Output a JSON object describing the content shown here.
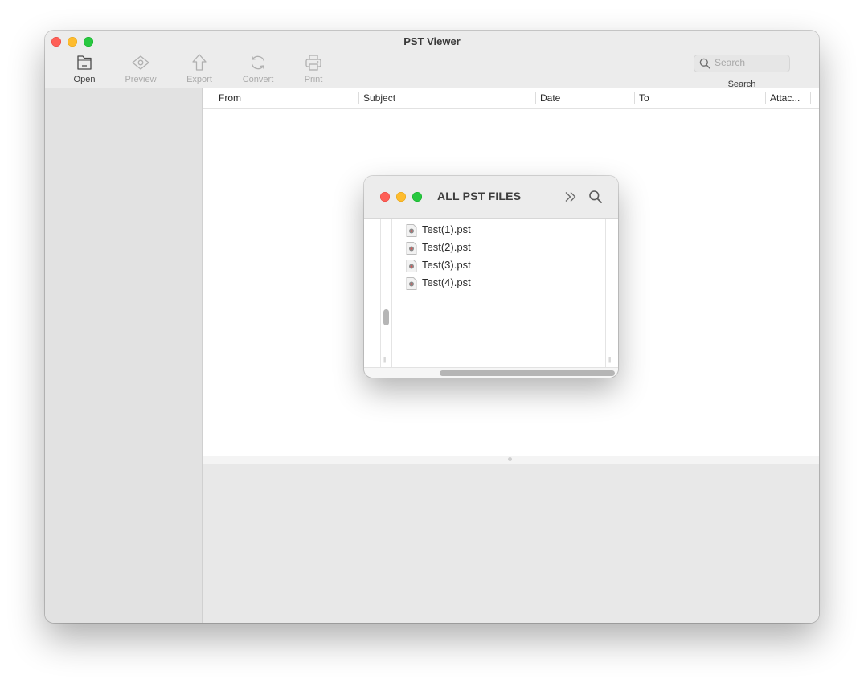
{
  "window": {
    "title": "PST Viewer"
  },
  "toolbar": {
    "open_label": "Open",
    "preview_label": "Preview",
    "export_label": "Export",
    "convert_label": "Convert",
    "print_label": "Print",
    "search_placeholder": "Search",
    "search_label": "Search"
  },
  "table": {
    "columns": [
      "From",
      "Subject",
      "Date",
      "To",
      "Attac..."
    ]
  },
  "dialog": {
    "title": "ALL PST FILES",
    "files": [
      "Test(1).pst",
      "Test(2).pst",
      "Test(3).pst",
      "Test(4).pst"
    ]
  },
  "colors": {
    "close": "#fe5f57",
    "minimize": "#febc2e",
    "maximize": "#28c840",
    "window_bg": "#ececec",
    "sidebar_bg": "#e2e2e2"
  }
}
